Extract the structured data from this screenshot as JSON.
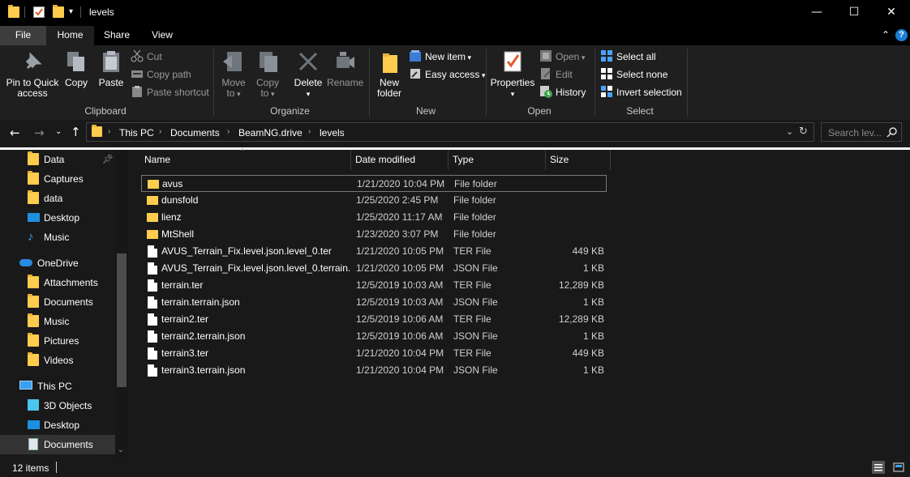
{
  "window": {
    "title": "levels",
    "minimize_glyph": "—",
    "maximize_glyph": "☐",
    "close_glyph": "✕"
  },
  "tabs": {
    "file": "File",
    "home": "Home",
    "share": "Share",
    "view": "View"
  },
  "ribbon": {
    "clipboard": {
      "label": "Clipboard",
      "pin_line1": "Pin to Quick",
      "pin_line2": "access",
      "copy": "Copy",
      "paste": "Paste",
      "cut": "Cut",
      "copy_path": "Copy path",
      "paste_shortcut": "Paste shortcut"
    },
    "organize": {
      "label": "Organize",
      "move_to_line1": "Move",
      "move_to_line2": "to",
      "copy_to_line1": "Copy",
      "copy_to_line2": "to",
      "delete": "Delete",
      "rename": "Rename"
    },
    "new": {
      "label": "New",
      "new_folder_line1": "New",
      "new_folder_line2": "folder",
      "new_item": "New item",
      "easy_access": "Easy access"
    },
    "open": {
      "label": "Open",
      "properties": "Properties",
      "open": "Open",
      "edit": "Edit",
      "history": "History"
    },
    "select": {
      "label": "Select",
      "select_all": "Select all",
      "select_none": "Select none",
      "invert_selection": "Invert selection"
    }
  },
  "address": {
    "crumbs": [
      "This PC",
      "Documents",
      "BeamNG.drive",
      "levels"
    ],
    "search_placeholder": "Search lev..."
  },
  "nav": {
    "items": [
      {
        "label": "Data",
        "icon": "folder-icon",
        "pinned": true
      },
      {
        "label": "Captures",
        "icon": "folder-icon"
      },
      {
        "label": "data",
        "icon": "folder-icon"
      },
      {
        "label": "Desktop",
        "icon": "desktop-icon"
      },
      {
        "label": "Music",
        "icon": "music-icon"
      },
      {
        "label": "OneDrive",
        "icon": "cloud-icon"
      },
      {
        "label": "Attachments",
        "icon": "folder-icon"
      },
      {
        "label": "Documents",
        "icon": "folder-icon"
      },
      {
        "label": "Music",
        "icon": "folder-icon"
      },
      {
        "label": "Pictures",
        "icon": "folder-icon"
      },
      {
        "label": "Videos",
        "icon": "folder-icon"
      },
      {
        "label": "This PC",
        "icon": "computer-icon"
      },
      {
        "label": "3D Objects",
        "icon": "cube-icon"
      },
      {
        "label": "Desktop",
        "icon": "desktop-icon"
      },
      {
        "label": "Documents",
        "icon": "documents-icon"
      }
    ]
  },
  "columns": {
    "name": "Name",
    "date": "Date modified",
    "type": "Type",
    "size": "Size"
  },
  "files": [
    {
      "name": "avus",
      "date": "1/21/2020 10:04 PM",
      "type": "File folder",
      "size": "",
      "kind": "folder"
    },
    {
      "name": "dunsfold",
      "date": "1/25/2020 2:45 PM",
      "type": "File folder",
      "size": "",
      "kind": "folder"
    },
    {
      "name": "lienz",
      "date": "1/25/2020 11:17 AM",
      "type": "File folder",
      "size": "",
      "kind": "folder"
    },
    {
      "name": "MtShell",
      "date": "1/23/2020 3:07 PM",
      "type": "File folder",
      "size": "",
      "kind": "folder"
    },
    {
      "name": "AVUS_Terrain_Fix.level.json.level_0.ter",
      "date": "1/21/2020 10:05 PM",
      "type": "TER File",
      "size": "449 KB",
      "kind": "file"
    },
    {
      "name": "AVUS_Terrain_Fix.level.json.level_0.terrain...",
      "date": "1/21/2020 10:05 PM",
      "type": "JSON File",
      "size": "1 KB",
      "kind": "file"
    },
    {
      "name": "terrain.ter",
      "date": "12/5/2019 10:03 AM",
      "type": "TER File",
      "size": "12,289 KB",
      "kind": "file"
    },
    {
      "name": "terrain.terrain.json",
      "date": "12/5/2019 10:03 AM",
      "type": "JSON File",
      "size": "1 KB",
      "kind": "file"
    },
    {
      "name": "terrain2.ter",
      "date": "12/5/2019 10:06 AM",
      "type": "TER File",
      "size": "12,289 KB",
      "kind": "file"
    },
    {
      "name": "terrain2.terrain.json",
      "date": "12/5/2019 10:06 AM",
      "type": "JSON File",
      "size": "1 KB",
      "kind": "file"
    },
    {
      "name": "terrain3.ter",
      "date": "1/21/2020 10:04 PM",
      "type": "TER File",
      "size": "449 KB",
      "kind": "file"
    },
    {
      "name": "terrain3.terrain.json",
      "date": "1/21/2020 10:04 PM",
      "type": "JSON File",
      "size": "1 KB",
      "kind": "file"
    }
  ],
  "status": {
    "item_count": "12 items"
  },
  "colors": {
    "folder": "#ffcc4d",
    "accent": "#0078d7",
    "background": "#191919"
  }
}
